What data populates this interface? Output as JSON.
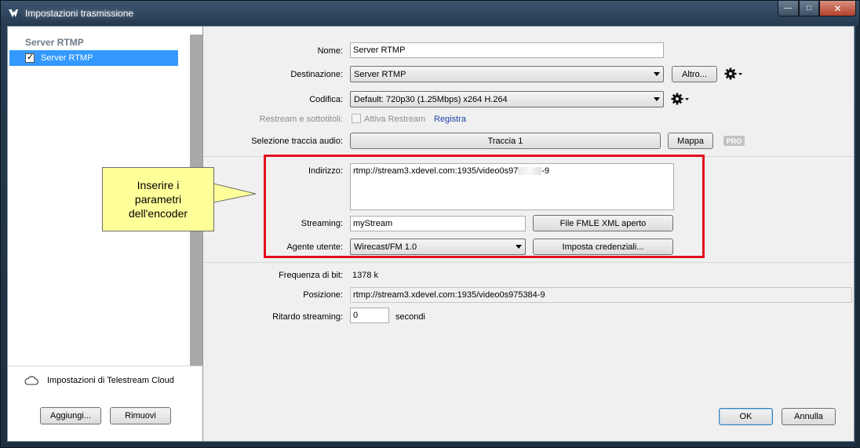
{
  "window": {
    "title": "Impostazioni trasmissione",
    "controls": {
      "minimize": "—",
      "maximize": "□",
      "close": "✕"
    }
  },
  "sidebar": {
    "header": "Server RTMP",
    "items": [
      {
        "label": "Server RTMP",
        "checked": true
      }
    ],
    "cloud_label": "Impostazioni di Telestream Cloud",
    "add_label": "Aggiungi...",
    "remove_label": "Rimuovi"
  },
  "form": {
    "name_label": "Nome:",
    "name_value": "Server RTMP",
    "destination_label": "Destinazione:",
    "destination_value": "Server RTMP",
    "more_label": "Altro...",
    "encoding_label": "Codifica:",
    "encoding_value": "Default: 720p30 (1.25Mbps) x264 H.264",
    "restream_label": "Restream e sottotitoli:",
    "restream_checkbox_label": "Attiva Restream",
    "register_link": "Registra",
    "audio_track_label": "Selezione traccia audio:",
    "audio_track_value": "Traccia 1",
    "map_label": "Mappa",
    "pro_badge": "PRO",
    "address_label": "Indirizzo:",
    "address_value_start": "rtmp://stream3.xdevel.com:1935/video0s97",
    "address_value_end": "-9",
    "streaming_label": "Streaming:",
    "streaming_value": "myStream",
    "fmle_button": "File FMLE XML aperto",
    "user_agent_label": "Agente utente:",
    "user_agent_value": "Wirecast/FM 1.0",
    "credentials_button": "Imposta credenziali...",
    "bitrate_label": "Frequenza di bit:",
    "bitrate_value": "1378 k",
    "position_label": "Posizione:",
    "position_value": "rtmp://stream3.xdevel.com:1935/video0s975384-9",
    "delay_label": "Ritardo streaming:",
    "delay_value": "0",
    "delay_unit": "secondi"
  },
  "footer": {
    "ok_label": "OK",
    "cancel_label": "Annulla"
  },
  "annotation": {
    "callout_lines": [
      "Inserire i",
      "parametri",
      "dell'encoder"
    ],
    "highlight_color": "#e3111b",
    "callout_color": "#ffff9a"
  }
}
